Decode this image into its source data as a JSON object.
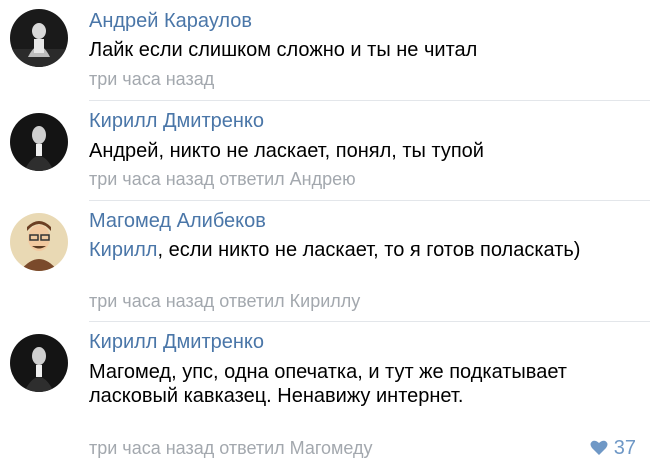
{
  "comments": [
    {
      "author": "Андрей Караулов",
      "text": "Лайк если слишком сложно и ты не читал",
      "meta": "три часа назад"
    },
    {
      "author": "Кирилл Дмитренко",
      "text": "Андрей, никто не ласкает, понял, ты тупой",
      "meta": "три часа назад ответил Андрею"
    },
    {
      "author": "Магомед Алибеков",
      "mention": "Кирилл",
      "text": ", если никто не ласкает, то я готов поласкать)",
      "meta": "три часа назад ответил Кириллу"
    },
    {
      "author": "Кирилл Дмитренко",
      "text": "Магомед, упс, одна опечатка, и тут же подкатывает ласковый кавказец. Ненавижу интернет.",
      "meta": "три часа назад ответил Магомеду",
      "likes": "37"
    }
  ],
  "icons": {
    "like": "heart-icon"
  },
  "colors": {
    "author": "#4a76a8",
    "meta": "#a3a8ae",
    "like": "#6f98c6",
    "divider": "#e3e6ea"
  }
}
